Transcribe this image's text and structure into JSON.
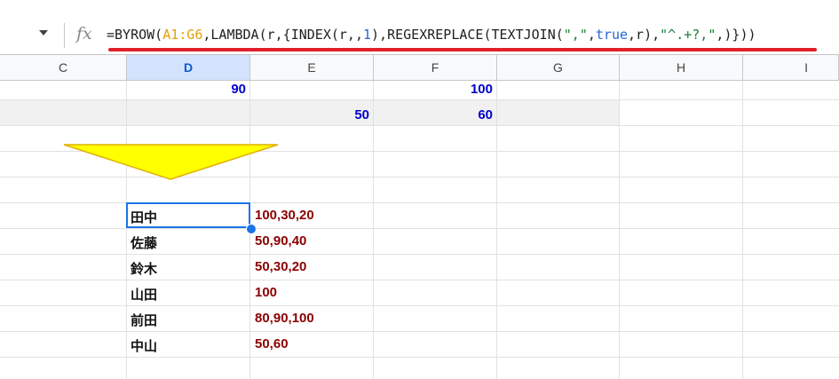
{
  "formula_bar": {
    "fx_label": "fx",
    "formula_parts": [
      {
        "text": "=BYROW(",
        "kind": "plain"
      },
      {
        "text": "A1:G6",
        "kind": "range"
      },
      {
        "text": ",LAMBDA(r,{INDEX(r,,",
        "kind": "plain"
      },
      {
        "text": "1",
        "kind": "num"
      },
      {
        "text": "),REGEXREPLACE(TEXTJOIN(",
        "kind": "plain"
      },
      {
        "text": "\",\"",
        "kind": "str"
      },
      {
        "text": ",",
        "kind": "plain"
      },
      {
        "text": "true",
        "kind": "bool"
      },
      {
        "text": ",r),",
        "kind": "plain"
      },
      {
        "text": "\"^.+?,\"",
        "kind": "str"
      },
      {
        "text": ",)}))",
        "kind": "plain"
      }
    ]
  },
  "columns": [
    "C",
    "D",
    "E",
    "F",
    "G",
    "H",
    "I"
  ],
  "cells": {
    "d1": "90",
    "f1": "100",
    "e2": "50",
    "f2": "60"
  },
  "results": [
    {
      "name": "田中",
      "values": "100,30,20"
    },
    {
      "name": "佐藤",
      "values": "50,90,40"
    },
    {
      "name": "鈴木",
      "values": "50,30,20"
    },
    {
      "name": "山田",
      "values": "100"
    },
    {
      "name": "前田",
      "values": "80,90,100"
    },
    {
      "name": "中山",
      "values": "50,60"
    }
  ],
  "colors": {
    "selection": "#1a73e8",
    "arrow_fill": "#ffff00",
    "result_text": "#8b0000",
    "number_text": "#0000cc",
    "highlight_underline": "#e0202a"
  }
}
